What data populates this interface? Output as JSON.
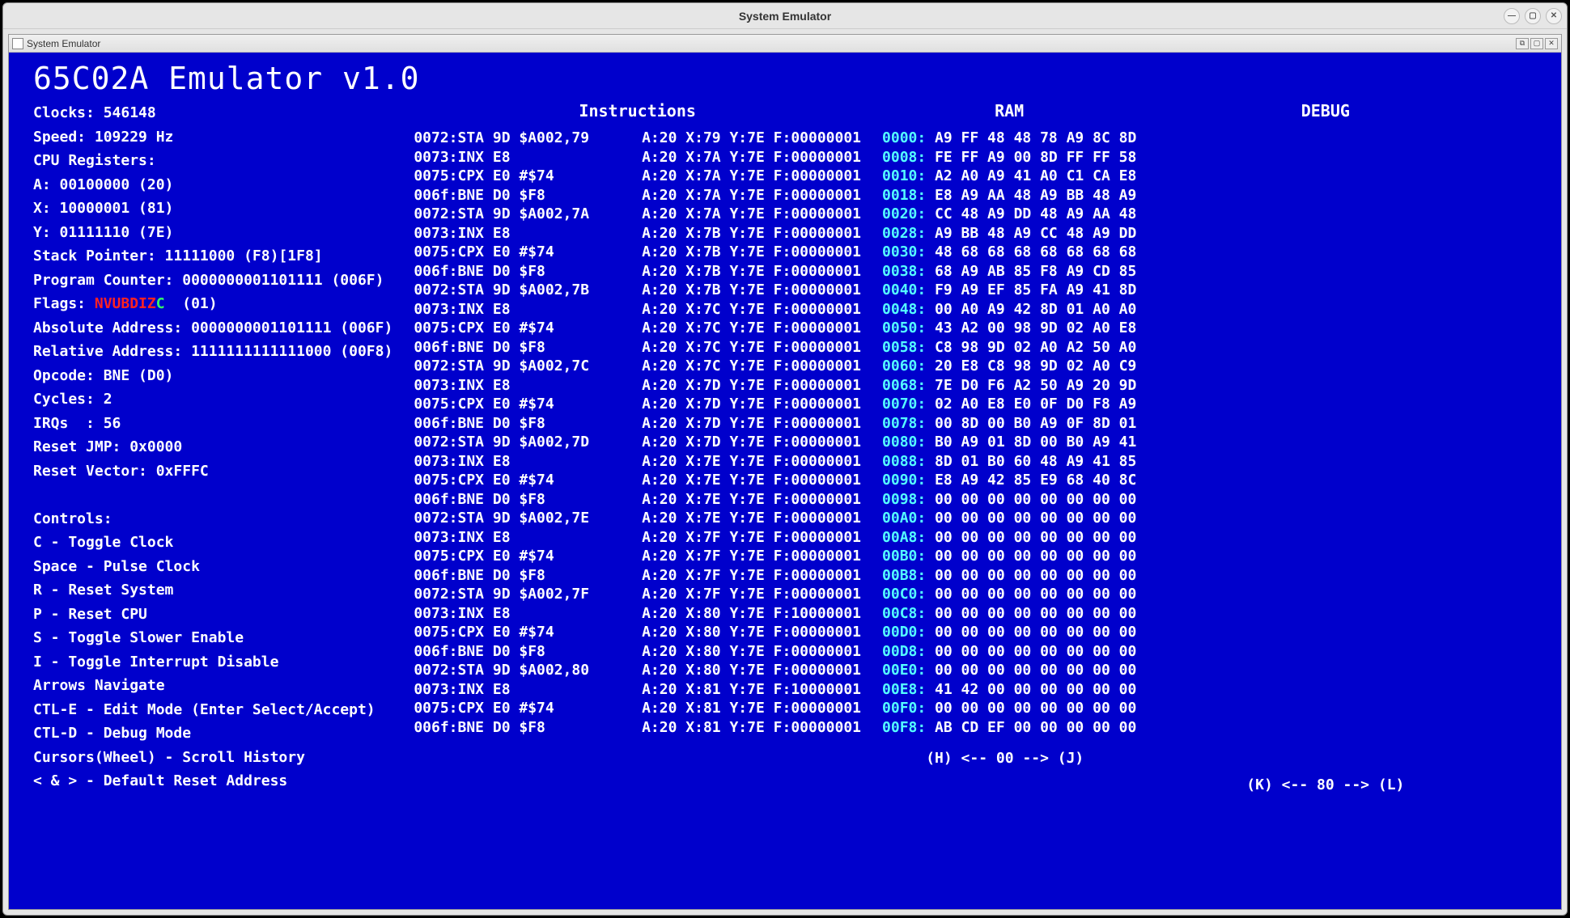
{
  "outer_window": {
    "title": "System Emulator"
  },
  "inner_window": {
    "title": "System Emulator"
  },
  "app": {
    "title": "65C02A Emulator v1.0"
  },
  "status": {
    "clocks_label": "Clocks:",
    "clocks": "546148",
    "speed_label": "Speed:",
    "speed": "109229 Hz"
  },
  "cpu": {
    "heading": "CPU Registers:",
    "A_label": "A:",
    "A_bin": "00100000",
    "A_hex": "(20)",
    "X_label": "X:",
    "X_bin": "10000001",
    "X_hex": "(81)",
    "Y_label": "Y:",
    "Y_bin": "01111110",
    "Y_hex": "(7E)",
    "SP_label": "Stack Pointer:",
    "SP_bin": "11111000",
    "SP_hex": "(F8)[1F8]",
    "PC_label": "Program Counter:",
    "PC_bin": "0000000001101111",
    "PC_hex": "(006F)",
    "Flags_label": "Flags:",
    "Flags_red": "NVUBDIZ",
    "Flags_green": "C",
    "Flags_hex": "(01)",
    "Abs_label": "Absolute Address:",
    "Abs_bin": "0000000001101111",
    "Abs_hex": "(006F)",
    "Rel_label": "Relative Address:",
    "Rel_bin": "1111111111111000",
    "Rel_hex": "(00F8)",
    "Opcode_label": "Opcode:",
    "Opcode": "BNE (D0)",
    "Cycles_label": "Cycles:",
    "Cycles": "2",
    "IRQs_label": "IRQs  :",
    "IRQs": "56",
    "ResetJMP_label": "Reset JMP:",
    "ResetJMP": "0x0000",
    "ResetVec_label": "Reset Vector:",
    "ResetVec": "0xFFFC"
  },
  "controls": {
    "heading": "Controls:",
    "lines": [
      "C - Toggle Clock",
      "Space - Pulse Clock",
      "R - Reset System",
      "P - Reset CPU",
      "S - Toggle Slower Enable",
      "I - Toggle Interrupt Disable",
      "Arrows Navigate",
      "CTL-E - Edit Mode (Enter Select/Accept)",
      "CTL-D - Debug Mode",
      "Cursors(Wheel) - Scroll History",
      "< & > - Default Reset Address"
    ]
  },
  "headers": {
    "instructions": "Instructions",
    "ram": "RAM",
    "debug": "DEBUG"
  },
  "instructions": [
    {
      "addr": "0072",
      "op": "STA 9D $A002,79",
      "reg": "A:20 X:79 Y:7E F:00000001"
    },
    {
      "addr": "0073",
      "op": "INX E8",
      "reg": "A:20 X:7A Y:7E F:00000001"
    },
    {
      "addr": "0075",
      "op": "CPX E0 #$74",
      "reg": "A:20 X:7A Y:7E F:00000001"
    },
    {
      "addr": "006f",
      "op": "BNE D0 $F8",
      "reg": "A:20 X:7A Y:7E F:00000001"
    },
    {
      "addr": "0072",
      "op": "STA 9D $A002,7A",
      "reg": "A:20 X:7A Y:7E F:00000001"
    },
    {
      "addr": "0073",
      "op": "INX E8",
      "reg": "A:20 X:7B Y:7E F:00000001"
    },
    {
      "addr": "0075",
      "op": "CPX E0 #$74",
      "reg": "A:20 X:7B Y:7E F:00000001"
    },
    {
      "addr": "006f",
      "op": "BNE D0 $F8",
      "reg": "A:20 X:7B Y:7E F:00000001"
    },
    {
      "addr": "0072",
      "op": "STA 9D $A002,7B",
      "reg": "A:20 X:7B Y:7E F:00000001"
    },
    {
      "addr": "0073",
      "op": "INX E8",
      "reg": "A:20 X:7C Y:7E F:00000001"
    },
    {
      "addr": "0075",
      "op": "CPX E0 #$74",
      "reg": "A:20 X:7C Y:7E F:00000001"
    },
    {
      "addr": "006f",
      "op": "BNE D0 $F8",
      "reg": "A:20 X:7C Y:7E F:00000001"
    },
    {
      "addr": "0072",
      "op": "STA 9D $A002,7C",
      "reg": "A:20 X:7C Y:7E F:00000001"
    },
    {
      "addr": "0073",
      "op": "INX E8",
      "reg": "A:20 X:7D Y:7E F:00000001"
    },
    {
      "addr": "0075",
      "op": "CPX E0 #$74",
      "reg": "A:20 X:7D Y:7E F:00000001"
    },
    {
      "addr": "006f",
      "op": "BNE D0 $F8",
      "reg": "A:20 X:7D Y:7E F:00000001"
    },
    {
      "addr": "0072",
      "op": "STA 9D $A002,7D",
      "reg": "A:20 X:7D Y:7E F:00000001"
    },
    {
      "addr": "0073",
      "op": "INX E8",
      "reg": "A:20 X:7E Y:7E F:00000001"
    },
    {
      "addr": "0075",
      "op": "CPX E0 #$74",
      "reg": "A:20 X:7E Y:7E F:00000001"
    },
    {
      "addr": "006f",
      "op": "BNE D0 $F8",
      "reg": "A:20 X:7E Y:7E F:00000001"
    },
    {
      "addr": "0072",
      "op": "STA 9D $A002,7E",
      "reg": "A:20 X:7E Y:7E F:00000001"
    },
    {
      "addr": "0073",
      "op": "INX E8",
      "reg": "A:20 X:7F Y:7E F:00000001"
    },
    {
      "addr": "0075",
      "op": "CPX E0 #$74",
      "reg": "A:20 X:7F Y:7E F:00000001"
    },
    {
      "addr": "006f",
      "op": "BNE D0 $F8",
      "reg": "A:20 X:7F Y:7E F:00000001"
    },
    {
      "addr": "0072",
      "op": "STA 9D $A002,7F",
      "reg": "A:20 X:7F Y:7E F:00000001"
    },
    {
      "addr": "0073",
      "op": "INX E8",
      "reg": "A:20 X:80 Y:7E F:10000001"
    },
    {
      "addr": "0075",
      "op": "CPX E0 #$74",
      "reg": "A:20 X:80 Y:7E F:00000001"
    },
    {
      "addr": "006f",
      "op": "BNE D0 $F8",
      "reg": "A:20 X:80 Y:7E F:00000001"
    },
    {
      "addr": "0072",
      "op": "STA 9D $A002,80",
      "reg": "A:20 X:80 Y:7E F:00000001"
    },
    {
      "addr": "0073",
      "op": "INX E8",
      "reg": "A:20 X:81 Y:7E F:10000001"
    },
    {
      "addr": "0075",
      "op": "CPX E0 #$74",
      "reg": "A:20 X:81 Y:7E F:00000001"
    },
    {
      "addr": "006f",
      "op": "BNE D0 $F8",
      "reg": "A:20 X:81 Y:7E F:00000001"
    }
  ],
  "ram": [
    {
      "addr": "0000",
      "bytes": "A9 FF 48 48 78 A9 8C 8D"
    },
    {
      "addr": "0008",
      "bytes": "FE FF A9 00 8D FF FF 58"
    },
    {
      "addr": "0010",
      "bytes": "A2 A0 A9 41 A0 C1 CA E8"
    },
    {
      "addr": "0018",
      "bytes": "E8 A9 AA 48 A9 BB 48 A9"
    },
    {
      "addr": "0020",
      "bytes": "CC 48 A9 DD 48 A9 AA 48"
    },
    {
      "addr": "0028",
      "bytes": "A9 BB 48 A9 CC 48 A9 DD"
    },
    {
      "addr": "0030",
      "bytes": "48 68 68 68 68 68 68 68"
    },
    {
      "addr": "0038",
      "bytes": "68 A9 AB 85 F8 A9 CD 85"
    },
    {
      "addr": "0040",
      "bytes": "F9 A9 EF 85 FA A9 41 8D"
    },
    {
      "addr": "0048",
      "bytes": "00 A0 A9 42 8D 01 A0 A0"
    },
    {
      "addr": "0050",
      "bytes": "43 A2 00 98 9D 02 A0 E8"
    },
    {
      "addr": "0058",
      "bytes": "C8 98 9D 02 A0 A2 50 A0"
    },
    {
      "addr": "0060",
      "bytes": "20 E8 C8 98 9D 02 A0 C9"
    },
    {
      "addr": "0068",
      "bytes": "7E D0 F6 A2 50 A9 20 9D"
    },
    {
      "addr": "0070",
      "bytes": "02 A0 E8 E0 0F D0 F8 A9"
    },
    {
      "addr": "0078",
      "bytes": "00 8D 00 B0 A9 0F 8D 01"
    },
    {
      "addr": "0080",
      "bytes": "B0 A9 01 8D 00 B0 A9 41"
    },
    {
      "addr": "0088",
      "bytes": "8D 01 B0 60 48 A9 41 85"
    },
    {
      "addr": "0090",
      "bytes": "E8 A9 42 85 E9 68 40 8C"
    },
    {
      "addr": "0098",
      "bytes": "00 00 00 00 00 00 00 00"
    },
    {
      "addr": "00A0",
      "bytes": "00 00 00 00 00 00 00 00"
    },
    {
      "addr": "00A8",
      "bytes": "00 00 00 00 00 00 00 00"
    },
    {
      "addr": "00B0",
      "bytes": "00 00 00 00 00 00 00 00"
    },
    {
      "addr": "00B8",
      "bytes": "00 00 00 00 00 00 00 00"
    },
    {
      "addr": "00C0",
      "bytes": "00 00 00 00 00 00 00 00"
    },
    {
      "addr": "00C8",
      "bytes": "00 00 00 00 00 00 00 00"
    },
    {
      "addr": "00D0",
      "bytes": "00 00 00 00 00 00 00 00"
    },
    {
      "addr": "00D8",
      "bytes": "00 00 00 00 00 00 00 00"
    },
    {
      "addr": "00E0",
      "bytes": "00 00 00 00 00 00 00 00"
    },
    {
      "addr": "00E8",
      "bytes": "41 42 00 00 00 00 00 00"
    },
    {
      "addr": "00F0",
      "bytes": "00 00 00 00 00 00 00 00"
    },
    {
      "addr": "00F8",
      "bytes": "AB CD EF 00 00 00 00 00"
    }
  ],
  "nav": {
    "ram": "(H) <-- 00 --> (J)",
    "debug": "(K) <-- 80 --> (L)"
  }
}
